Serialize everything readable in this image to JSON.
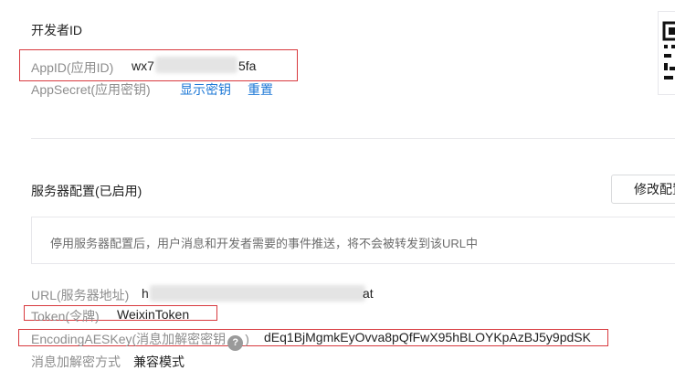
{
  "developer": {
    "section_title": "开发者ID",
    "appid_label": "AppID(应用ID)",
    "appid_prefix": "wx7",
    "appid_suffix": "5fa",
    "appsecret_label": "AppSecret(应用密钥)",
    "show_secret_link": "显示密钥",
    "reset_link": "重置"
  },
  "server": {
    "section_title": "服务器配置(已启用)",
    "modify_button": "修改配置",
    "notice": "停用服务器配置后，用户消息和开发者需要的事件推送，将不会被转发到该URL中",
    "url_label": "URL(服务器地址)",
    "url_prefix": "h",
    "url_suffix": "at",
    "token_label": "Token(令牌)",
    "token_value": "WeixinToken",
    "aeskey_label": "EncodingAESKey(消息加解密密钥",
    "aeskey_label_close": ")",
    "help_icon_glyph": "?",
    "aeskey_value": "dEq1BjMgmkEyOvva8pQfFwX95hBLOYKpAzBJ5y9pdSK",
    "encrypt_mode_label": "消息加解密方式",
    "encrypt_mode_value": "兼容模式"
  },
  "colors": {
    "highlight_box": "#d8393e",
    "link": "#1e78d6",
    "label": "#8d8d8d"
  }
}
